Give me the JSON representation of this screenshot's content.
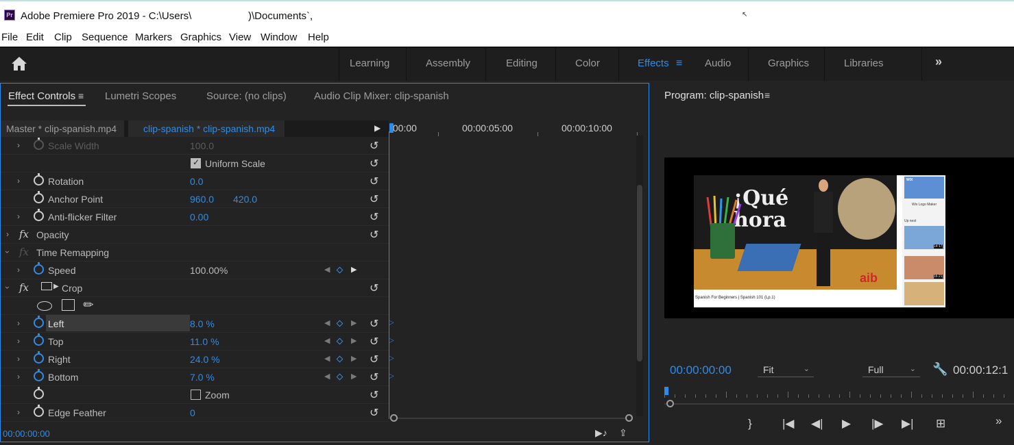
{
  "window": {
    "app_title": "Adobe Premiere Pro 2019 - C:\\Users\\",
    "path_tail": ")\\Documents`,"
  },
  "menu": [
    "File",
    "Edit",
    "Clip",
    "Sequence",
    "Markers",
    "Graphics",
    "View",
    "Window",
    "Help"
  ],
  "workspaces": [
    "Learning",
    "Assembly",
    "Editing",
    "Color",
    "Effects",
    "Audio",
    "Graphics",
    "Libraries"
  ],
  "active_workspace": "Effects",
  "panel_tabs": [
    "Effect Controls",
    "Lumetri Scopes",
    "Source: (no clips)",
    "Audio Clip Mixer: clip-spanish"
  ],
  "clip_bar": {
    "master": "Master * clip-spanish.mp4",
    "clip": "clip-spanish * clip-spanish.mp4"
  },
  "timeline": {
    "tc0": ":00:00",
    "tc1": "00:00:05:00",
    "tc2": "00:00:10:00"
  },
  "properties": {
    "scale_width": {
      "label": "Scale Width",
      "value": "100.0"
    },
    "uniform_scale": {
      "label": "Uniform Scale",
      "checked": true
    },
    "rotation": {
      "label": "Rotation",
      "value": "0.0"
    },
    "anchor_point": {
      "label": "Anchor Point",
      "x": "960.0",
      "y": "420.0"
    },
    "anti_flicker": {
      "label": "Anti-flicker Filter",
      "value": "0.00"
    },
    "opacity": {
      "label": "Opacity"
    },
    "time_remapping": {
      "label": "Time Remapping"
    },
    "speed": {
      "label": "Speed",
      "value": "100.00%"
    },
    "crop": {
      "label": "Crop"
    },
    "left": {
      "label": "Left",
      "value": "8.0 %"
    },
    "top": {
      "label": "Top",
      "value": "11.0 %"
    },
    "right": {
      "label": "Right",
      "value": "24.0 %"
    },
    "bottom": {
      "label": "Bottom",
      "value": "7.0 %"
    },
    "zoom": {
      "label": "Zoom",
      "checked": false
    },
    "edge_feather": {
      "label": "Edge Feather",
      "value": "0"
    }
  },
  "effect_controls_timecode": "00:00:00:00",
  "program": {
    "title": "Program: clip-spanish",
    "timecode": "00:00:00:00",
    "fit": "Fit",
    "quality": "Full",
    "duration": "00:00:12:1",
    "frame": {
      "overlay_1": "¡Qué",
      "overlay_2": "hora",
      "logo": "aib",
      "caption": "Spanish For Beginners | Spanish 101 (Lp.1)",
      "side_1": "WIX",
      "side_2": "Wix Logo Maker",
      "side_3": "Up next",
      "side_4": "14:17",
      "side_5": "16:21"
    }
  },
  "colors": {
    "accent": "#2d8ceb",
    "panel_bg": "#232323",
    "text": "#bcbcbc"
  }
}
